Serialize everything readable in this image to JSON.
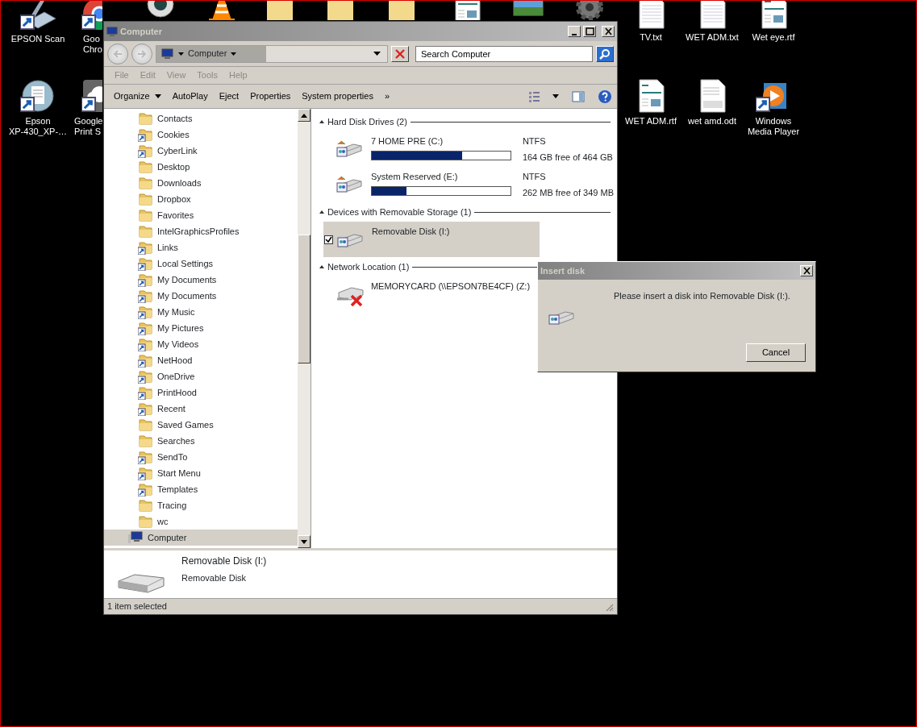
{
  "desktop_icons": [
    {
      "kind": "scanner",
      "lines": [
        "EPSON Scan"
      ],
      "shortcut": true
    },
    {
      "kind": "chrome",
      "lines": [
        "Goo",
        "Chro"
      ],
      "shortcut": true
    },
    {
      "kind": "webcam",
      "shortcut": false
    },
    {
      "kind": "cone",
      "shortcut": false
    },
    {
      "kind": "folder",
      "shortcut": false
    },
    {
      "kind": "folder",
      "shortcut": false
    },
    {
      "kind": "folder",
      "shortcut": false
    },
    {
      "kind": "rtf",
      "shortcut": false
    },
    {
      "kind": "photo",
      "shortcut": false
    },
    {
      "kind": "gear",
      "shortcut": false
    },
    {
      "kind": "txt",
      "lines": [
        "TV.txt"
      ],
      "shortcut": false
    },
    {
      "kind": "txt",
      "lines": [
        "WET ADM.txt"
      ],
      "shortcut": false
    },
    {
      "kind": "rtf",
      "lines": [
        "Wet eye.rtf"
      ],
      "shortcut": false
    },
    {
      "kind": "disc",
      "lines": [
        "Epson",
        "XP-430_XP-…"
      ],
      "shortcut": true
    },
    {
      "kind": "cloud",
      "lines": [
        "Google",
        "Print S"
      ],
      "shortcut": true
    },
    {
      "kind": "rtf",
      "lines": [
        "WET ADM.rtf"
      ],
      "shortcut": false
    },
    {
      "kind": "odt",
      "lines": [
        "wet amd.odt"
      ],
      "shortcut": false
    },
    {
      "kind": "player",
      "lines": [
        "Windows",
        "Media Player"
      ],
      "shortcut": true
    }
  ],
  "window": {
    "title": "Computer",
    "address": {
      "crumbs": [
        "Computer"
      ]
    },
    "search": {
      "placeholder": "Search Computer"
    },
    "menu": [
      "File",
      "Edit",
      "View",
      "Tools",
      "Help"
    ],
    "toolbar": [
      {
        "label": "Organize",
        "dropdown": true
      },
      {
        "label": "AutoPlay",
        "dropdown": false
      },
      {
        "label": "Eject",
        "dropdown": false
      },
      {
        "label": "Properties",
        "dropdown": false
      },
      {
        "label": "System properties",
        "dropdown": false
      },
      {
        "label": "»",
        "dropdown": false
      }
    ],
    "tree": [
      {
        "label": "Contacts",
        "shortcut": false,
        "selected": false
      },
      {
        "label": "Cookies",
        "shortcut": true,
        "selected": false
      },
      {
        "label": "CyberLink",
        "shortcut": true,
        "selected": false
      },
      {
        "label": "Desktop",
        "shortcut": false,
        "selected": false
      },
      {
        "label": "Downloads",
        "shortcut": false,
        "selected": false
      },
      {
        "label": "Dropbox",
        "shortcut": false,
        "selected": false
      },
      {
        "label": "Favorites",
        "shortcut": false,
        "selected": false
      },
      {
        "label": "IntelGraphicsProfiles",
        "shortcut": false,
        "selected": false
      },
      {
        "label": "Links",
        "shortcut": true,
        "selected": false
      },
      {
        "label": "Local Settings",
        "shortcut": true,
        "selected": false
      },
      {
        "label": "My Documents",
        "shortcut": true,
        "selected": false
      },
      {
        "label": "My Documents",
        "shortcut": true,
        "selected": false
      },
      {
        "label": "My Music",
        "shortcut": true,
        "selected": false
      },
      {
        "label": "My Pictures",
        "shortcut": true,
        "selected": false
      },
      {
        "label": "My Videos",
        "shortcut": true,
        "selected": false
      },
      {
        "label": "NetHood",
        "shortcut": true,
        "selected": false
      },
      {
        "label": "OneDrive",
        "shortcut": true,
        "selected": false
      },
      {
        "label": "PrintHood",
        "shortcut": true,
        "selected": false
      },
      {
        "label": "Recent",
        "shortcut": true,
        "selected": false
      },
      {
        "label": "Saved Games",
        "shortcut": false,
        "selected": false
      },
      {
        "label": "Searches",
        "shortcut": false,
        "selected": false
      },
      {
        "label": "SendTo",
        "shortcut": true,
        "selected": false
      },
      {
        "label": "Start Menu",
        "shortcut": true,
        "selected": false
      },
      {
        "label": "Templates",
        "shortcut": true,
        "selected": false
      },
      {
        "label": "Tracing",
        "shortcut": false,
        "selected": false
      },
      {
        "label": "wc",
        "shortcut": false,
        "selected": false
      },
      {
        "label": "Computer",
        "selected": true,
        "kind": "computer"
      }
    ],
    "groups": [
      {
        "title": "Hard Disk Drives (2)",
        "items": [
          {
            "kind": "disk",
            "name": "7 HOME PRE (C:)",
            "fs": "NTFS",
            "free": "164 GB free of 464 GB",
            "level": 0.65,
            "selected": false
          },
          {
            "kind": "disk",
            "name": "System Reserved (E:)",
            "fs": "NTFS",
            "free": "262 MB free of 349 MB",
            "level": 0.25,
            "selected": false
          }
        ]
      },
      {
        "title": "Devices with Removable Storage (1)",
        "items": [
          {
            "kind": "removable",
            "name": "Removable Disk (I:)",
            "selected": true,
            "checked": true
          }
        ]
      },
      {
        "title": "Network Location (1)",
        "items": [
          {
            "kind": "network",
            "name": "MEMORYCARD (\\\\EPSON7BE4CF) (Z:)",
            "selected": false
          }
        ]
      }
    ],
    "details": {
      "name": "Removable Disk (I:)",
      "type": "Removable Disk"
    },
    "status_bar": "1 item selected"
  },
  "dialog": {
    "title": "Insert disk",
    "message": "Please insert a disk into Removable Disk (I:).",
    "buttons": [
      "Cancel"
    ]
  }
}
